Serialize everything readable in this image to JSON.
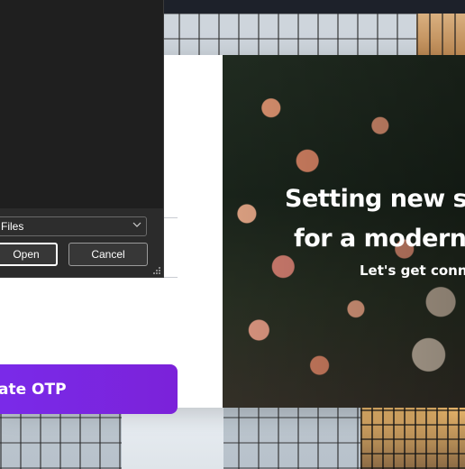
{
  "file_dialog": {
    "file_type_value": "Files",
    "open_label": "Open",
    "cancel_label": "Cancel"
  },
  "form": {
    "otp_button_label": "ate OTP"
  },
  "hero": {
    "line1": "Setting new st",
    "line2": "for a modern",
    "subtitle": "Let's get conne"
  },
  "colors": {
    "accent": "#7a2bea",
    "dialog_bg": "#202020"
  },
  "icons": [
    "chevron-down-icon",
    "resize-grip-icon"
  ]
}
